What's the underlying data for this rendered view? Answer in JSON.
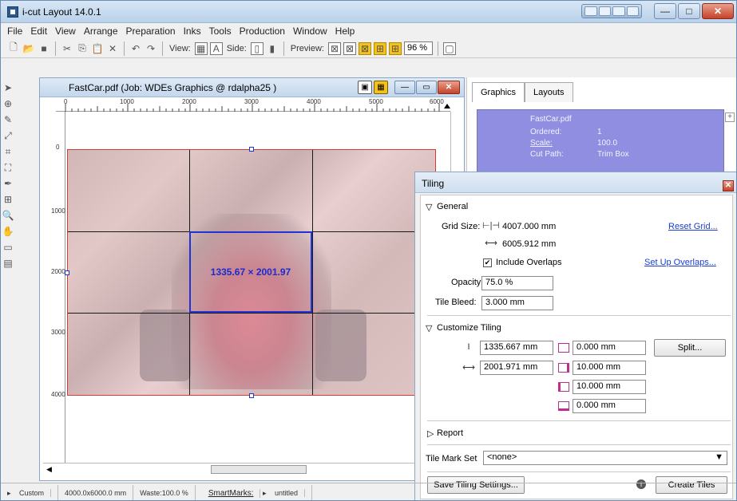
{
  "window": {
    "title": "i-cut Layout 14.0.1"
  },
  "menu": [
    "File",
    "Edit",
    "View",
    "Arrange",
    "Preparation",
    "Inks",
    "Tools",
    "Production",
    "Window",
    "Help"
  ],
  "toolbar": {
    "view_label": "View:",
    "side_label": "Side:",
    "preview_label": "Preview:",
    "zoom": "96 %"
  },
  "document": {
    "title": "FastCar.pdf (Job: WDEs Graphics @ rdalpha25 )",
    "ruler_h": [
      "0",
      "1000",
      "2000",
      "3000",
      "4000",
      "5000",
      "6000"
    ],
    "ruler_v": [
      "0",
      "1000",
      "2000",
      "3000",
      "4000"
    ],
    "tile_dimension": "1335.67 × 2001.97"
  },
  "statusbar": {
    "mode": "Custom",
    "size": "4000.0x6000.0 mm",
    "waste": "Waste:100.0 %",
    "smartmarks_label": "SmartMarks:",
    "smartmarks_value": "untitled"
  },
  "panel": {
    "tabs": [
      "Graphics",
      "Layouts"
    ],
    "graphic": {
      "name": "FastCar.pdf",
      "ordered_label": "Ordered:",
      "ordered": "1",
      "scale_label": "Scale:",
      "scale": "100.0",
      "cutpath_label": "Cut Path:",
      "cutpath": "Trim Box"
    }
  },
  "tiling": {
    "title": "Tiling",
    "general_label": "General",
    "grid_size_label": "Grid Size:",
    "grid_height": "4007.000 mm",
    "grid_width": "6005.912 mm",
    "reset_grid": "Reset Grid...",
    "include_overlaps": "Include Overlaps",
    "setup_overlaps": "Set Up Overlaps...",
    "opacity_label": "Opacity",
    "opacity": "75.0 %",
    "tile_bleed_label": "Tile Bleed:",
    "tile_bleed": "3.000 mm",
    "customize_label": "Customize Tiling",
    "tile_height": "1335.667 mm",
    "tile_width": "2001.971 mm",
    "overlap_top": "0.000 mm",
    "overlap_right": "10.000 mm",
    "overlap_bottom": "10.000 mm",
    "overlap_left": "0.000 mm",
    "split_button": "Split...",
    "report_label": "Report",
    "tile_mark_set_label": "Tile Mark Set",
    "tile_mark_set_value": "<none>",
    "save_button": "Save Tiling Settings...",
    "create_button": "Create Tiles"
  }
}
